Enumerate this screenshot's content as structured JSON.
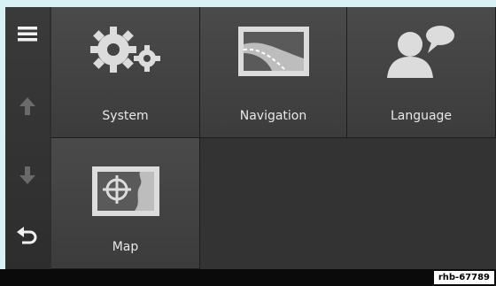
{
  "sidebar": {
    "items": [
      {
        "name": "menu",
        "icon": "menu-icon"
      },
      {
        "name": "scroll-up",
        "icon": "arrow-up-icon"
      },
      {
        "name": "scroll-down",
        "icon": "arrow-down-icon"
      },
      {
        "name": "back",
        "icon": "back-icon"
      }
    ]
  },
  "tiles": [
    {
      "label": "System",
      "icon": "gears-icon"
    },
    {
      "label": "Navigation",
      "icon": "road-icon"
    },
    {
      "label": "Language",
      "icon": "person-speech-icon"
    },
    {
      "label": "Map",
      "icon": "map-target-icon"
    }
  ],
  "footer": {
    "reference": "rhb-67789"
  },
  "colors": {
    "background": "#d7f1f4",
    "screen": "#2e2e2e",
    "tile": "#444444",
    "text": "#e8e8e8"
  }
}
